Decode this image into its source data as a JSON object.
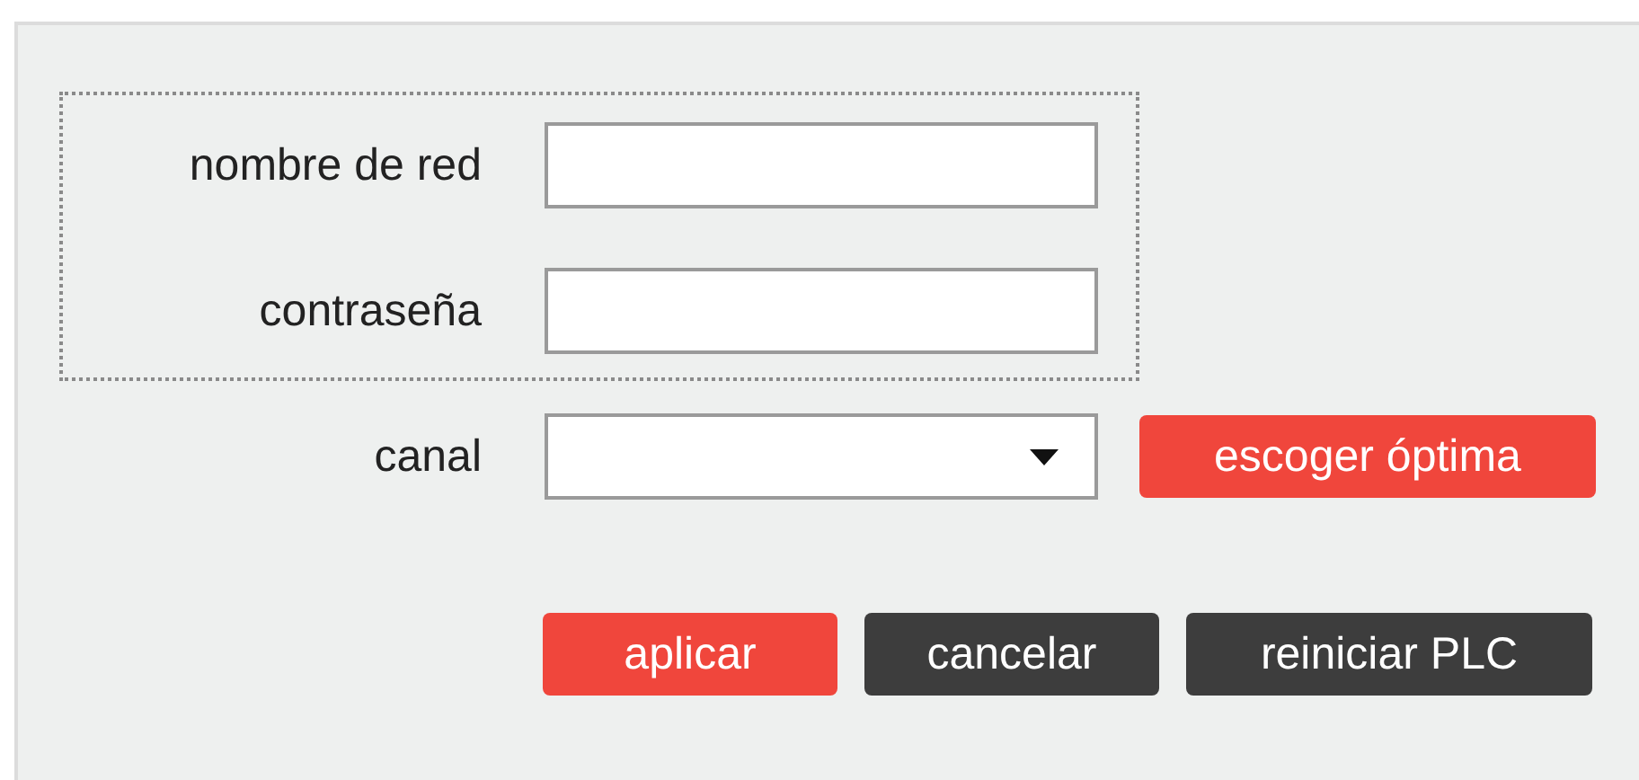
{
  "credentials": [
    {
      "label": "nombre de red"
    },
    {
      "label": "contraseña"
    }
  ],
  "channel": {
    "label": "canal",
    "kind": "select",
    "button": "escoger óptima"
  },
  "buttons": [
    {
      "label": "aplicar",
      "kind": "primary"
    },
    {
      "label": "cancelar",
      "kind": "secondary"
    },
    {
      "label": "reiniciar PLC",
      "kind": "secondary"
    }
  ]
}
